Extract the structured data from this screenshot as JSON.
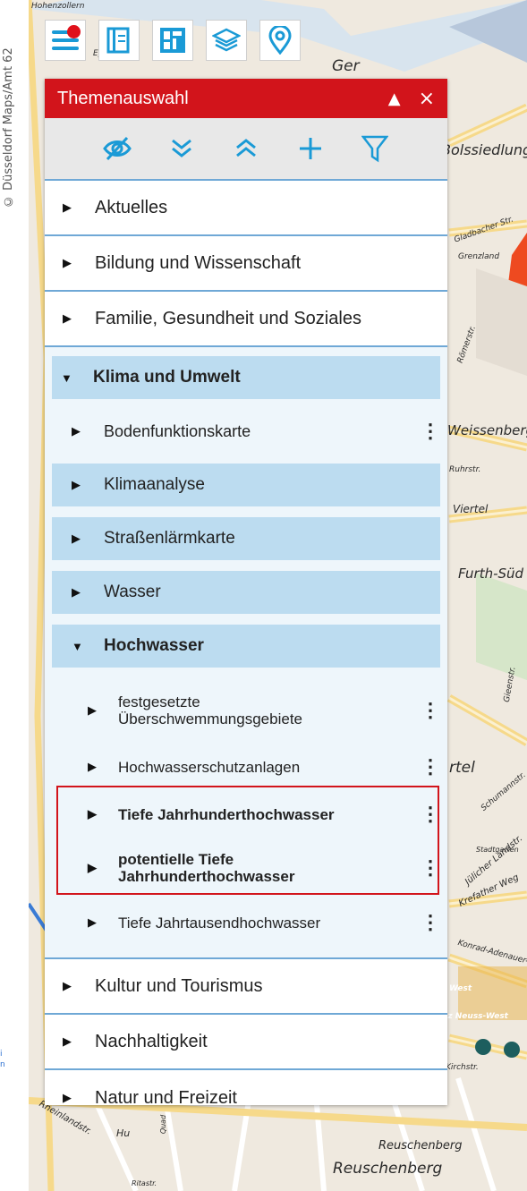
{
  "copyright": "© Düsseldorf Maps/Amt 62",
  "map": {
    "labels": [
      "Hohenzollern",
      "Eyth",
      "Ger",
      "Bolssiedlung",
      "Gladbacher Str.",
      "Grenzland",
      "Römerstr.",
      "Weissenberg",
      "Furth-Süd",
      "Viertel",
      "Ruhrstr.",
      "rtel",
      "Gieenstr.",
      "Schumannstr.",
      "Stadtgarten",
      "Krefather Weg",
      "Jülicher Landstr.",
      "Konrad-Adenauer-Ring",
      "West",
      "uz Neuss-West",
      "Kirchstr.",
      "Reuschenberg",
      "Reuschenberg",
      "Rheinlandstr.",
      "Ritastr.",
      "Hu",
      "Quad"
    ]
  },
  "edge_text": "i\nn",
  "toolbar": {
    "buttons": [
      {
        "icon": "menu-icon"
      },
      {
        "icon": "book-icon"
      },
      {
        "icon": "map-layout-icon"
      },
      {
        "icon": "layers-icon"
      },
      {
        "icon": "location-icon"
      }
    ]
  },
  "panel": {
    "title": "Themenauswahl",
    "collapse_symbol": "▲",
    "close_symbol": "×",
    "icons": [
      "hide-icon",
      "expand-all-icon",
      "collapse-all-icon",
      "add-icon",
      "filter-icon"
    ],
    "categories_top": [
      "Aktuelles",
      "Bildung und Wissenschaft",
      "Familie, Gesundheit und Soziales"
    ],
    "expanded_category": "Klima und Umwelt",
    "subcategories": [
      "Bodenfunktionskarte",
      "Klimaanalyse",
      "Straßenlärmkarte",
      "Wasser"
    ],
    "expanded_sub": "Hochwasser",
    "layers": [
      {
        "label": "festgesetzte\nÜberschwemmungsgebiete",
        "bold": false
      },
      {
        "label": "Hochwasserschutzanlagen",
        "bold": false
      },
      {
        "label": "Tiefe Jahrhunderthochwasser",
        "bold": true
      },
      {
        "label": "potentielle Tiefe\nJahrhunderthochwasser",
        "bold": true
      },
      {
        "label": "Tiefe Jahrtausendhochwasser",
        "bold": false
      }
    ],
    "categories_bottom": [
      "Kultur und Tourismus",
      "Nachhaltigkeit",
      "Natur und Freizeit"
    ],
    "kebab": "⋮",
    "arrow_right": "▶",
    "arrow_down": "▼"
  },
  "colors": {
    "header_red": "#d2141b",
    "highlight_blue": "#bcdcf0",
    "divider_blue": "#6fa8d6"
  }
}
